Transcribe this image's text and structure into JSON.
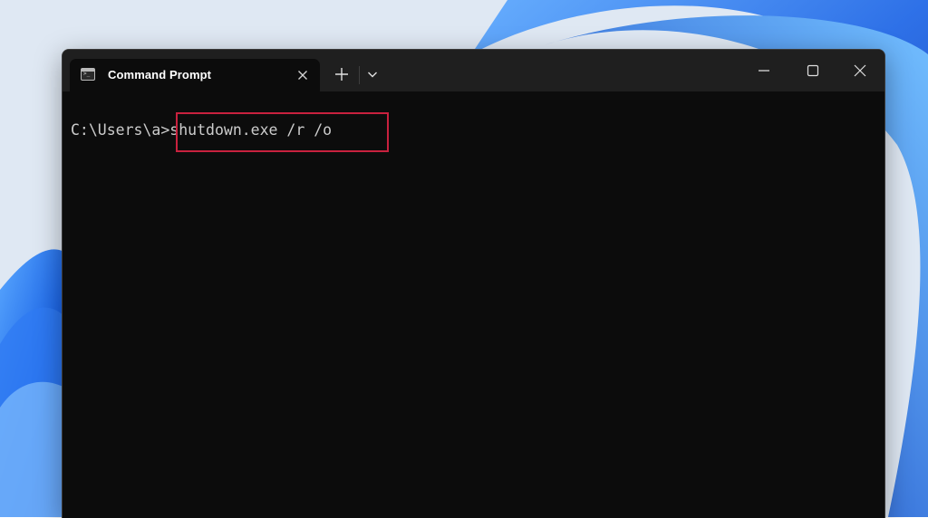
{
  "window": {
    "tab_title": "Command Prompt",
    "tab_icon": "terminal-icon",
    "new_tab_icon": "plus-icon",
    "dropdown_icon": "chevron-down-icon",
    "controls": {
      "minimize_icon": "minimize-icon",
      "maximize_icon": "maximize-icon",
      "close_icon": "close-icon"
    }
  },
  "terminal": {
    "prompt": "C:\\Users\\a>",
    "command": "shutdown.exe /r /o"
  },
  "colors": {
    "terminal_bg": "#0c0c0c",
    "titlebar_bg": "#1f1f1f",
    "text": "#cccccc",
    "highlight_border": "#c8213e",
    "wallpaper_blue": "#1a5fe0"
  }
}
